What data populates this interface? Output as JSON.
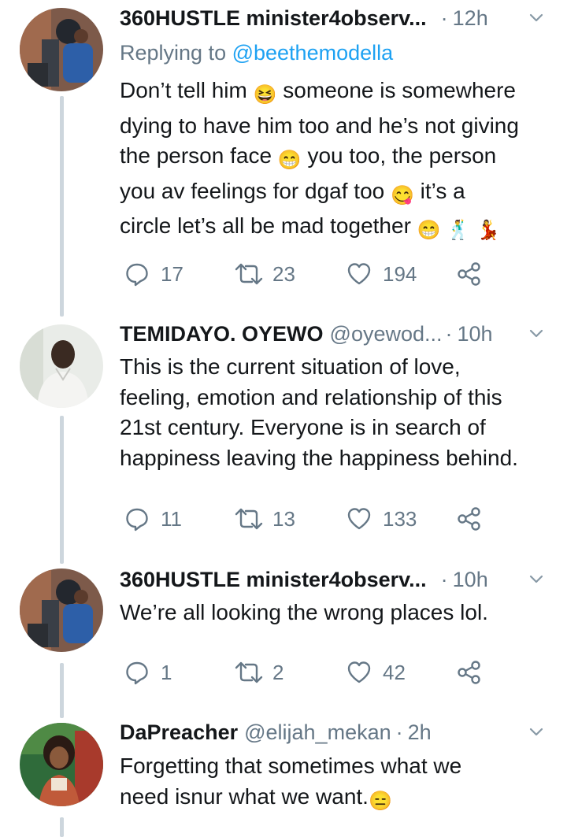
{
  "icons": {
    "reply": "reply-bubble-icon",
    "retweet": "retweet-icon",
    "like": "heart-icon",
    "share": "share-icon",
    "menu": "chevron-down-icon"
  },
  "colors": {
    "secondary_text": "#657786",
    "link": "#1da1f2",
    "thread_line": "#cdd6dd"
  },
  "tweets": [
    {
      "name": "360HUSTLE minister4observ...",
      "handle": "",
      "separator": "·",
      "time": "12h",
      "replying_prefix": "Replying to ",
      "replying_handle": "@beethemodella",
      "text_lines": [
        "Don’t tell him",
        "someone is somewhere",
        "dying to have him too and he’s not giving",
        "the person face",
        "you too, the person",
        "you av feelings for dgaf too",
        "it’s a",
        "circle let’s all be mad together"
      ],
      "emojis": [
        "😆",
        "😁",
        "😋",
        "😁",
        "🕺",
        "💃"
      ],
      "replies": "17",
      "retweets": "23",
      "likes": "194"
    },
    {
      "name": "TEMIDAYO. OYEWO",
      "handle": "@oyewod...",
      "separator": "·",
      "time": "10h",
      "text_lines": [
        "This is the current situation of love,",
        "feeling, emotion and relationship of this",
        "21st century. Everyone is in search of",
        "happiness leaving the happiness behind."
      ],
      "replies": "11",
      "retweets": "13",
      "likes": "133"
    },
    {
      "name": "360HUSTLE minister4observ...",
      "handle": "",
      "separator": "·",
      "time": "10h",
      "text_lines": [
        "We’re all looking the wrong places lol."
      ],
      "replies": "1",
      "retweets": "2",
      "likes": "42"
    },
    {
      "name": "DaPreacher",
      "handle": "@elijah_mekan",
      "separator": "·",
      "time": "2h",
      "text_lines": [
        "Forgetting that sometimes what we",
        "need isnur what we want."
      ],
      "emojis": [
        "😑"
      ]
    }
  ]
}
